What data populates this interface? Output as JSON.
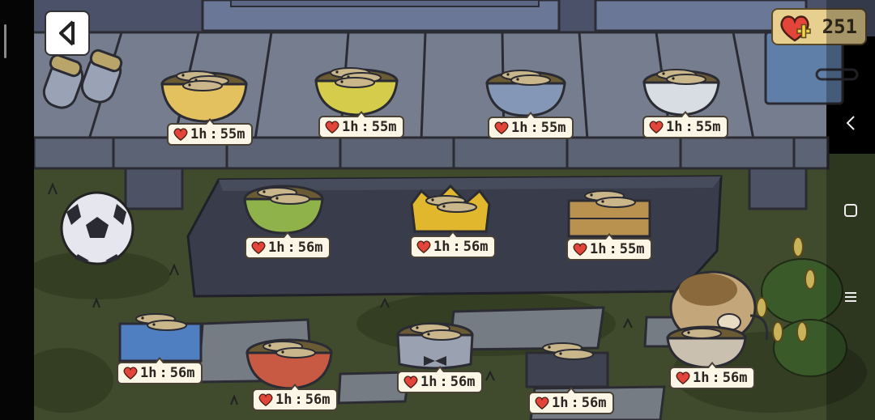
{
  "hud": {
    "hearts": "251",
    "back_icon": "back-arrow-icon",
    "add_hearts_icon": "heart-plus-icon"
  },
  "bowls": [
    {
      "id": "paw-bowl",
      "timer_hours": "1h",
      "timer_minutes": "55m"
    },
    {
      "id": "yellow-bowl",
      "timer_hours": "1h",
      "timer_minutes": "55m"
    },
    {
      "id": "blue-dotted-bowl",
      "timer_hours": "1h",
      "timer_minutes": "55m"
    },
    {
      "id": "white-bowl",
      "timer_hours": "1h",
      "timer_minutes": "55m"
    },
    {
      "id": "green-bowl",
      "timer_hours": "1h",
      "timer_minutes": "56m"
    },
    {
      "id": "crown-bowl",
      "timer_hours": "1h",
      "timer_minutes": "56m"
    },
    {
      "id": "wooden-box-bowl",
      "timer_hours": "1h",
      "timer_minutes": "55m"
    },
    {
      "id": "blue-wave-bowl",
      "timer_hours": "1h",
      "timer_minutes": "56m"
    },
    {
      "id": "red-dotted-bowl",
      "timer_hours": "1h",
      "timer_minutes": "56m"
    },
    {
      "id": "bowtie-bowl",
      "timer_hours": "1h",
      "timer_minutes": "56m"
    },
    {
      "id": "dark-box-bowl",
      "timer_hours": "1h",
      "timer_minutes": "56m"
    },
    {
      "id": "cat-bowl",
      "timer_hours": "1h",
      "timer_minutes": "56m"
    }
  ],
  "nav": {
    "back": "chevron-left-icon",
    "home": "square-icon",
    "menu": "menu-icon"
  },
  "colors": {
    "grass": "#3d4a2a",
    "deck": "#6c7487",
    "stone": "#3d4150",
    "timer_bg": "#fbf6e6",
    "heart": "#e4453a"
  }
}
